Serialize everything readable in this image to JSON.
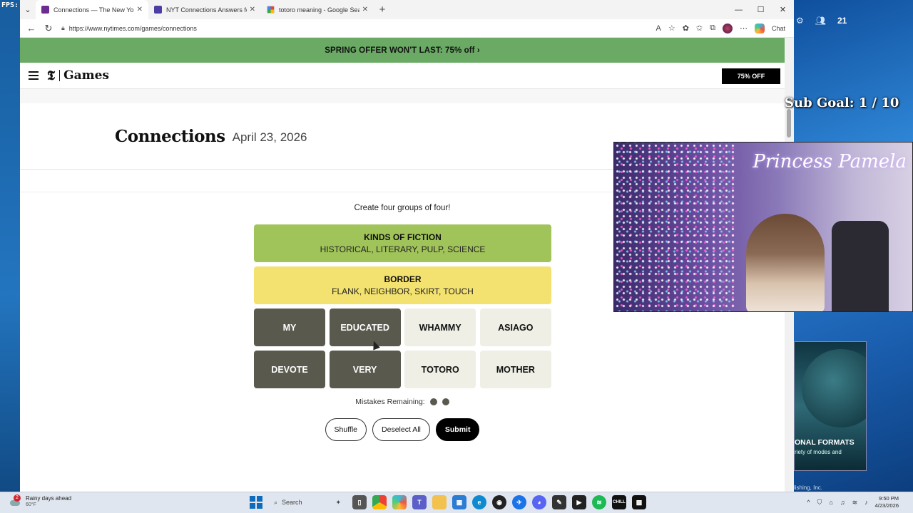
{
  "overlay": {
    "fps_label": "FPS:",
    "viewer_count": "21",
    "sub_goal": "Sub Goal: 1 / 10",
    "streamer_name": "Princess Pamela",
    "ad_title": "ONAL FORMATS",
    "ad_subtitle": "riety of modes and",
    "publisher_text": "lishing, Inc."
  },
  "browser": {
    "tabs": [
      {
        "title": "Connections — The New York Tim",
        "favicon_color": "#6b2d8f"
      },
      {
        "title": "NYT Connections Answers for Apr",
        "favicon_color": "#4b3ea5"
      },
      {
        "title": "totoro meaning - Google Search",
        "favicon_color": "#ffffff"
      }
    ],
    "url": "https://www.nytimes.com/games/connections",
    "copilot_label": "Chat"
  },
  "page": {
    "promo_text": "SPRING OFFER WON'T LAST: 75% off ›",
    "logo_text": "Games",
    "offer_button": "75% OFF",
    "title": "Connections",
    "date": "April 23, 2026",
    "instructions": "Create four groups of four!",
    "solved_groups": [
      {
        "title": "KINDS OF FICTION",
        "words": "HISTORICAL, LITERARY, PULP, SCIENCE",
        "color": "#a0c35a"
      },
      {
        "title": "BORDER",
        "words": "FLANK, NEIGHBOR, SKIRT, TOUCH",
        "color": "#f3e170"
      }
    ],
    "tiles": [
      {
        "label": "MY",
        "selected": true
      },
      {
        "label": "EDUCATED",
        "selected": true
      },
      {
        "label": "WHAMMY",
        "selected": false
      },
      {
        "label": "ASIAGO",
        "selected": false
      },
      {
        "label": "DEVOTE",
        "selected": true
      },
      {
        "label": "VERY",
        "selected": true
      },
      {
        "label": "TOTORO",
        "selected": false
      },
      {
        "label": "MOTHER",
        "selected": false
      }
    ],
    "mistakes_label": "Mistakes Remaining:",
    "mistakes_remaining": 2,
    "buttons": {
      "shuffle": "Shuffle",
      "deselect": "Deselect All",
      "submit": "Submit"
    }
  },
  "taskbar": {
    "weather_text": "Rainy days ahead",
    "weather_temp": "60°F",
    "weather_badge": "2",
    "search_placeholder": "Search",
    "time": "9:50 PM",
    "date": "4/23/2026"
  }
}
